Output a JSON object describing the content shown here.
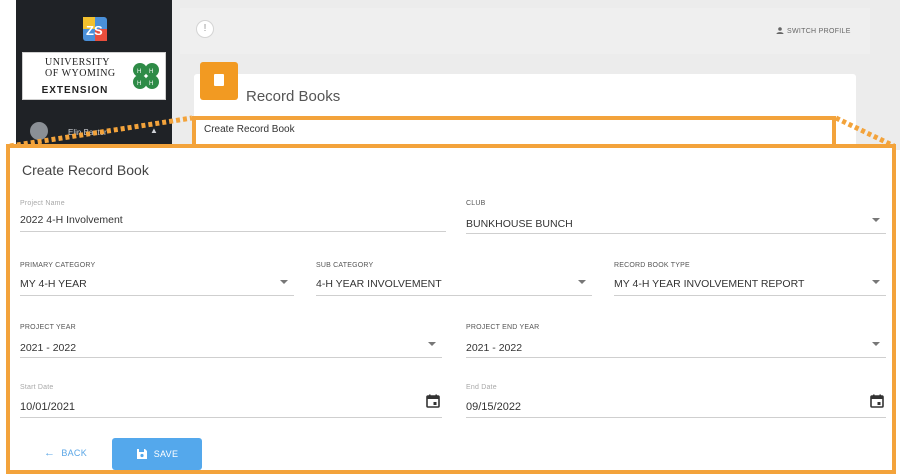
{
  "app": {
    "university_logo_text": [
      "UNIVERSITY",
      "OF WYOMING"
    ],
    "extension_text": "EXTENSION",
    "user_name": "Elin Baxter",
    "switch_profile": "SWITCH PROFILE",
    "alert_glyph": "!"
  },
  "page": {
    "title": "Record Books",
    "breadcrumb_card": "Create Record Book"
  },
  "form": {
    "title": "Create Record Book",
    "project_name": {
      "label": "Project Name",
      "value": "2022 4-H Involvement"
    },
    "club": {
      "label": "CLUB",
      "value": "BUNKHOUSE BUNCH"
    },
    "primary_category": {
      "label": "PRIMARY CATEGORY",
      "value": "MY 4-H YEAR"
    },
    "sub_category": {
      "label": "SUB CATEGORY",
      "value": "4-H YEAR INVOLVEMENT"
    },
    "record_book_type": {
      "label": "RECORD BOOK TYPE",
      "value": "MY 4-H YEAR INVOLVEMENT REPORT"
    },
    "project_year": {
      "label": "PROJECT YEAR",
      "value": "2021 - 2022"
    },
    "project_end_year": {
      "label": "PROJECT END YEAR",
      "value": "2021 - 2022"
    },
    "start_date": {
      "label": "Start Date",
      "value": "10/01/2021"
    },
    "end_date": {
      "label": "End Date",
      "value": "09/15/2022"
    },
    "back_label": "BACK",
    "save_label": "SAVE"
  },
  "colors": {
    "accent_orange": "#f3a33b",
    "save_blue": "#54a8ec",
    "back_blue": "#5aa6e6",
    "sidebar_dark": "#1f2226"
  },
  "icons": [
    "zs-logo-icon",
    "clover-icon",
    "alert-icon",
    "person-icon",
    "book-icon",
    "chevron-down-icon",
    "calendar-icon",
    "arrow-left-icon",
    "save-icon"
  ]
}
